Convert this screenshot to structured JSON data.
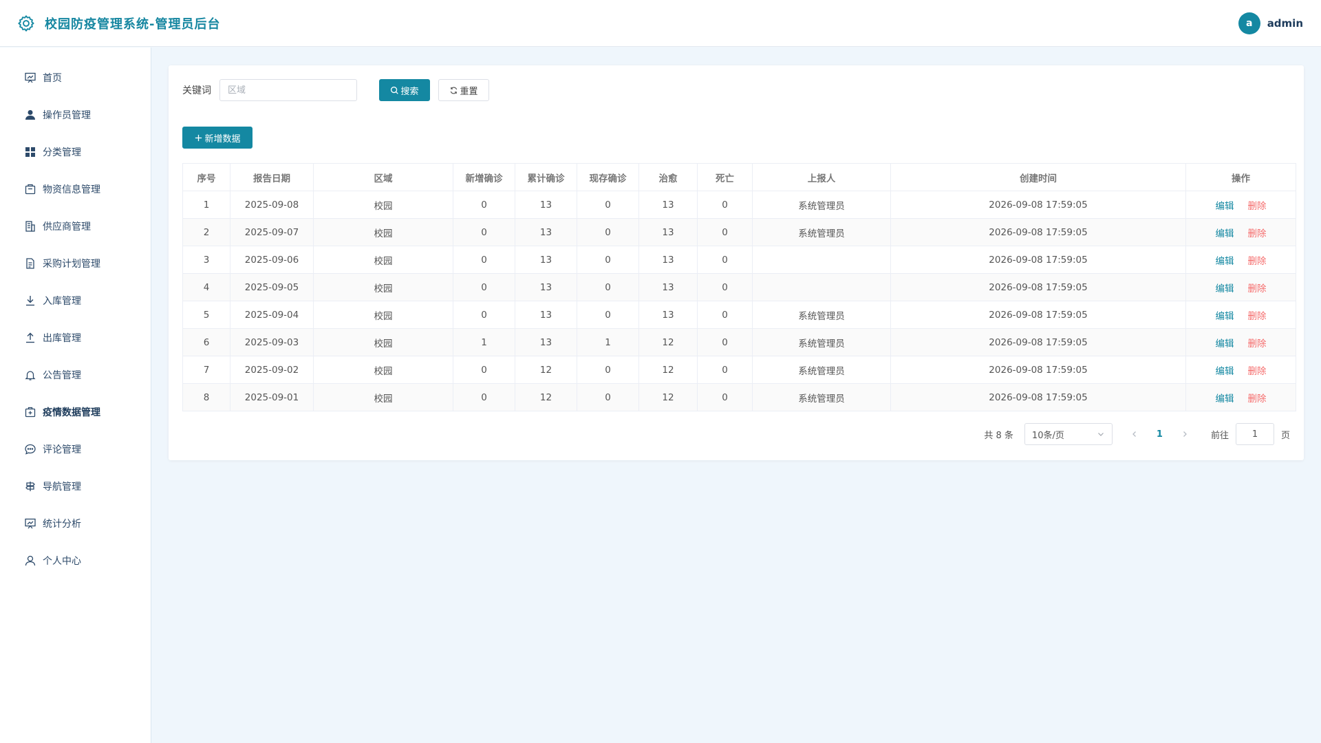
{
  "header": {
    "title": "校园防疫管理系统-管理员后台",
    "avatar_letter": "a",
    "username": "admin"
  },
  "sidebar": {
    "items": [
      {
        "label": "首页",
        "icon": "home-chart-icon"
      },
      {
        "label": "操作员管理",
        "icon": "user-icon"
      },
      {
        "label": "分类管理",
        "icon": "grid-icon"
      },
      {
        "label": "物资信息管理",
        "icon": "package-icon"
      },
      {
        "label": "供应商管理",
        "icon": "building-icon"
      },
      {
        "label": "采购计划管理",
        "icon": "document-icon"
      },
      {
        "label": "入库管理",
        "icon": "download-icon"
      },
      {
        "label": "出库管理",
        "icon": "upload-icon"
      },
      {
        "label": "公告管理",
        "icon": "bell-icon"
      },
      {
        "label": "疫情数据管理",
        "icon": "medical-box-icon",
        "active": true
      },
      {
        "label": "评论管理",
        "icon": "chat-icon"
      },
      {
        "label": "导航管理",
        "icon": "guide-icon"
      },
      {
        "label": "统计分析",
        "icon": "stats-icon"
      },
      {
        "label": "个人中心",
        "icon": "person-icon"
      }
    ]
  },
  "search": {
    "keyword_label": "关键词",
    "placeholder": "区域",
    "value": "",
    "search_label": "搜索",
    "reset_label": "重置"
  },
  "toolbar": {
    "add_label": "新增数据"
  },
  "table": {
    "columns": [
      "序号",
      "报告日期",
      "区域",
      "新增确诊",
      "累计确诊",
      "现存确诊",
      "治愈",
      "死亡",
      "上报人",
      "创建时间",
      "操作"
    ],
    "edit_label": "编辑",
    "delete_label": "删除",
    "rows": [
      [
        "1",
        "2025-09-08",
        "校园",
        "0",
        "13",
        "0",
        "13",
        "0",
        "系统管理员",
        "2026-09-08 17:59:05"
      ],
      [
        "2",
        "2025-09-07",
        "校园",
        "0",
        "13",
        "0",
        "13",
        "0",
        "系统管理员",
        "2026-09-08 17:59:05"
      ],
      [
        "3",
        "2025-09-06",
        "校园",
        "0",
        "13",
        "0",
        "13",
        "0",
        "",
        "2026-09-08 17:59:05"
      ],
      [
        "4",
        "2025-09-05",
        "校园",
        "0",
        "13",
        "0",
        "13",
        "0",
        "",
        "2026-09-08 17:59:05"
      ],
      [
        "5",
        "2025-09-04",
        "校园",
        "0",
        "13",
        "0",
        "13",
        "0",
        "系统管理员",
        "2026-09-08 17:59:05"
      ],
      [
        "6",
        "2025-09-03",
        "校园",
        "1",
        "13",
        "1",
        "12",
        "0",
        "系统管理员",
        "2026-09-08 17:59:05"
      ],
      [
        "7",
        "2025-09-02",
        "校园",
        "0",
        "12",
        "0",
        "12",
        "0",
        "系统管理员",
        "2026-09-08 17:59:05"
      ],
      [
        "8",
        "2025-09-01",
        "校园",
        "0",
        "12",
        "0",
        "12",
        "0",
        "系统管理员",
        "2026-09-08 17:59:05"
      ]
    ]
  },
  "pagination": {
    "total_text": "共 8 条",
    "page_size": "10条/页",
    "current_page": "1",
    "goto_label": "前往",
    "goto_value": "1",
    "page_suffix": "页"
  },
  "colors": {
    "accent": "#1488a2",
    "danger": "#f56c6c",
    "background": "#eff6fc"
  }
}
